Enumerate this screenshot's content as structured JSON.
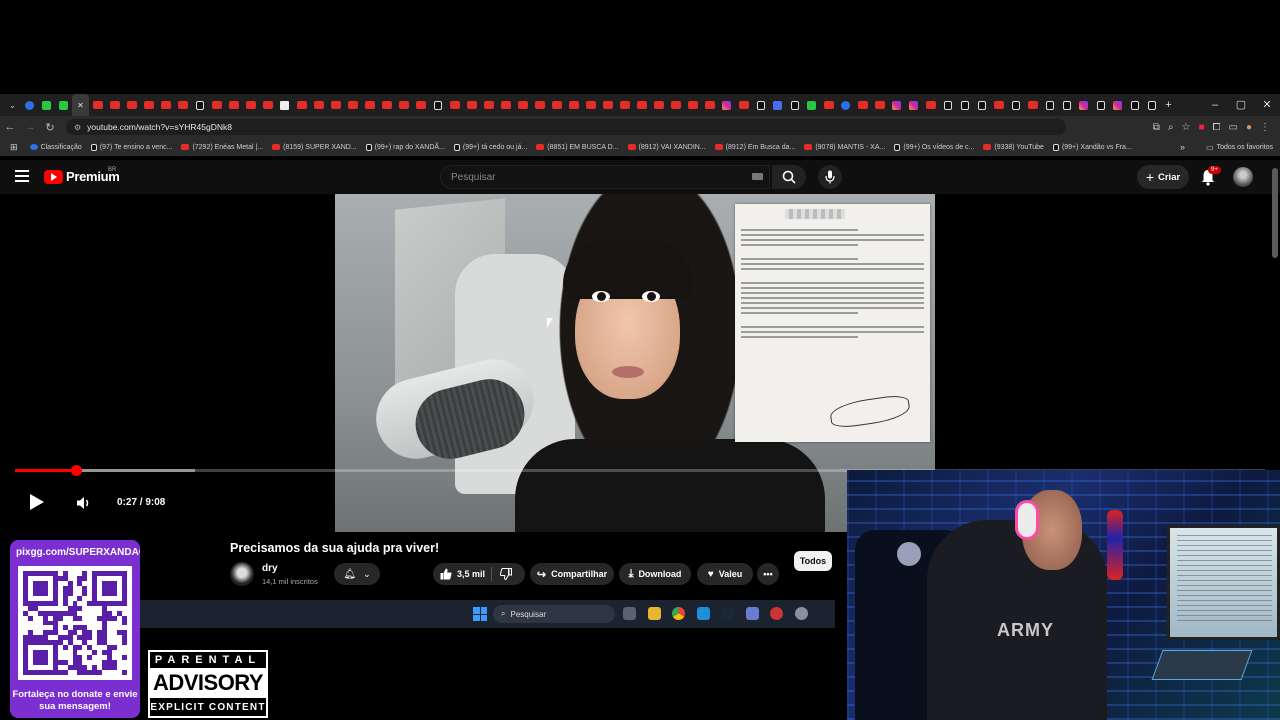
{
  "browser": {
    "address": "youtube.com/watch?v=sYHR45gDNk8",
    "bookmarks": [
      {
        "label": "Classificação",
        "icon": "blue"
      },
      {
        "label": "(97) Te ensino a venc...",
        "icon": "tk"
      },
      {
        "label": "(7292) Enéas Metal |...",
        "icon": "yt"
      },
      {
        "label": "(8159) SUPER XAND...",
        "icon": "yt"
      },
      {
        "label": "(99+) rap do XANDÃ...",
        "icon": "tk"
      },
      {
        "label": "(99+) tá cedo ou já...",
        "icon": "tk"
      },
      {
        "label": "(8851) EM BUSCA D...",
        "icon": "yt"
      },
      {
        "label": "(8912) VAI XANDIN...",
        "icon": "yt"
      },
      {
        "label": "(8912) Em Busca da...",
        "icon": "yt"
      },
      {
        "label": "(9078) MANTIS - XA...",
        "icon": "yt"
      },
      {
        "label": "(99+) Os vídeos de c...",
        "icon": "tk"
      },
      {
        "label": "(9338) YouTube",
        "icon": "yt"
      },
      {
        "label": "(99+) Xandão vs Fra...",
        "icon": "tk"
      }
    ],
    "bookmarks_more": "»",
    "all_favorites": "Todos os favoritos",
    "window_controls": [
      "–",
      "▢",
      "✕"
    ],
    "new_tab": "+"
  },
  "youtube": {
    "brand": "Premium",
    "region": "BR",
    "search_placeholder": "Pesquisar",
    "create_label": "Criar",
    "notif_badge": "9+"
  },
  "player": {
    "current_time": "0:27",
    "duration": "9:08",
    "time_display": "0:27 / 9:08",
    "progress_fraction": 0.049
  },
  "video_info": {
    "title": "Precisamos da sua ajuda pra viver!",
    "channel": "dry",
    "subscribers": "14,1 mil inscritos",
    "likes": "3,5 mil",
    "share_label": "Compartilhar",
    "download_label": "Download",
    "thanks_label": "Valeu",
    "chip_all": "Todos"
  },
  "taskbar": {
    "search_placeholder": "Pesquisar"
  },
  "overlay": {
    "donate_url": "pixgg.com/SUPERXANDAO",
    "donate_message": "Fortaleça no donate e envie sua mensagem!",
    "parental_top": "PARENTAL",
    "parental_mid": "ADVISORY",
    "parental_bot": "EXPLICIT CONTENT"
  },
  "webcam": {
    "shirt_text": "ARMY"
  },
  "colors": {
    "accent_red": "#ff0000",
    "donate_purple": "#7b2fd0",
    "taskbar": "#1c2330"
  }
}
